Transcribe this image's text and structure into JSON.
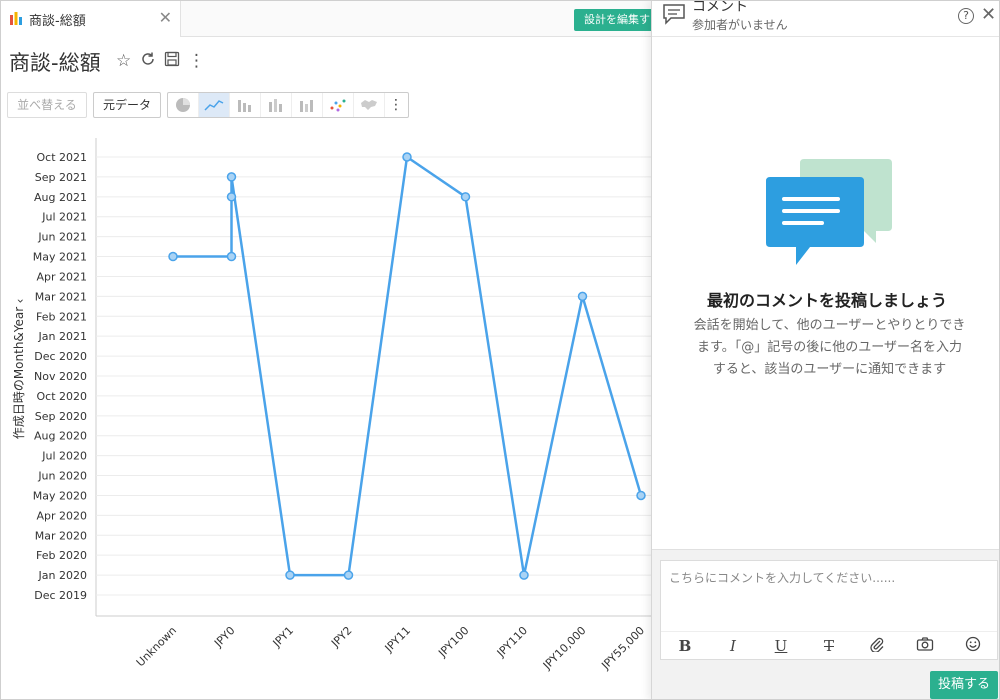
{
  "tab": {
    "label": "商談-総額"
  },
  "header": {
    "edit_design_label": "設計を編集する"
  },
  "report": {
    "title": "商談-総額"
  },
  "toolbar": {
    "sort_label": "並べ替える",
    "raw_data_label": "元データ"
  },
  "chart_data": {
    "type": "line",
    "ylabel": "作成日時のMonth&Year",
    "xlabel": "",
    "categories": [
      "Unknown",
      "JPY0",
      "JPY1",
      "JPY2",
      "JPY11",
      "JPY100",
      "JPY110",
      "JPY10,000",
      "JPY55,000"
    ],
    "y_ticks": [
      "Dec 2019",
      "Jan 2020",
      "Feb 2020",
      "Mar 2020",
      "Apr 2020",
      "May 2020",
      "Jun 2020",
      "Jul 2020",
      "Aug 2020",
      "Sep 2020",
      "Oct 2020",
      "Nov 2020",
      "Dec 2020",
      "Jan 2021",
      "Feb 2021",
      "Mar 2021",
      "Apr 2021",
      "May 2021",
      "Jun 2021",
      "Jul 2021",
      "Aug 2021",
      "Sep 2021",
      "Oct 2021"
    ],
    "points": [
      {
        "x": "Unknown",
        "y": "May 2021"
      },
      {
        "x": "JPY0",
        "y": "May 2021"
      },
      {
        "x": "JPY0",
        "y": "Aug 2021"
      },
      {
        "x": "JPY0",
        "y": "Sep 2021"
      },
      {
        "x": "JPY1",
        "y": "Jan 2020"
      },
      {
        "x": "JPY2",
        "y": "Jan 2020"
      },
      {
        "x": "JPY11",
        "y": "Oct 2021"
      },
      {
        "x": "JPY100",
        "y": "Aug 2021"
      },
      {
        "x": "JPY110",
        "y": "Jan 2020"
      },
      {
        "x": "JPY10,000",
        "y": "Mar 2021"
      },
      {
        "x": "JPY55,000",
        "y": "May 2020"
      }
    ],
    "grid": true,
    "line_color": "#4aa3ea"
  },
  "comments": {
    "title": "コメント",
    "subtitle": "参加者がいません",
    "empty_title": "最初のコメントを投稿しましょう",
    "empty_desc": "会話を開始して、他のユーザーとやりとりできます。「@」記号の後に他のユーザー名を入力すると、該当のユーザーに通知できます",
    "input_placeholder": "こちらにコメントを入力してください......",
    "post_label": "投稿する",
    "format_icons": [
      "bold-icon",
      "italic-icon",
      "underline-icon",
      "strikethrough-icon",
      "attachment-icon",
      "camera-icon",
      "emoji-icon"
    ]
  },
  "colors": {
    "accent": "#2bb08f",
    "line": "#4aa3ea",
    "bubble_blue": "#2d9ee0",
    "bubble_green": "#bfe3cf"
  }
}
